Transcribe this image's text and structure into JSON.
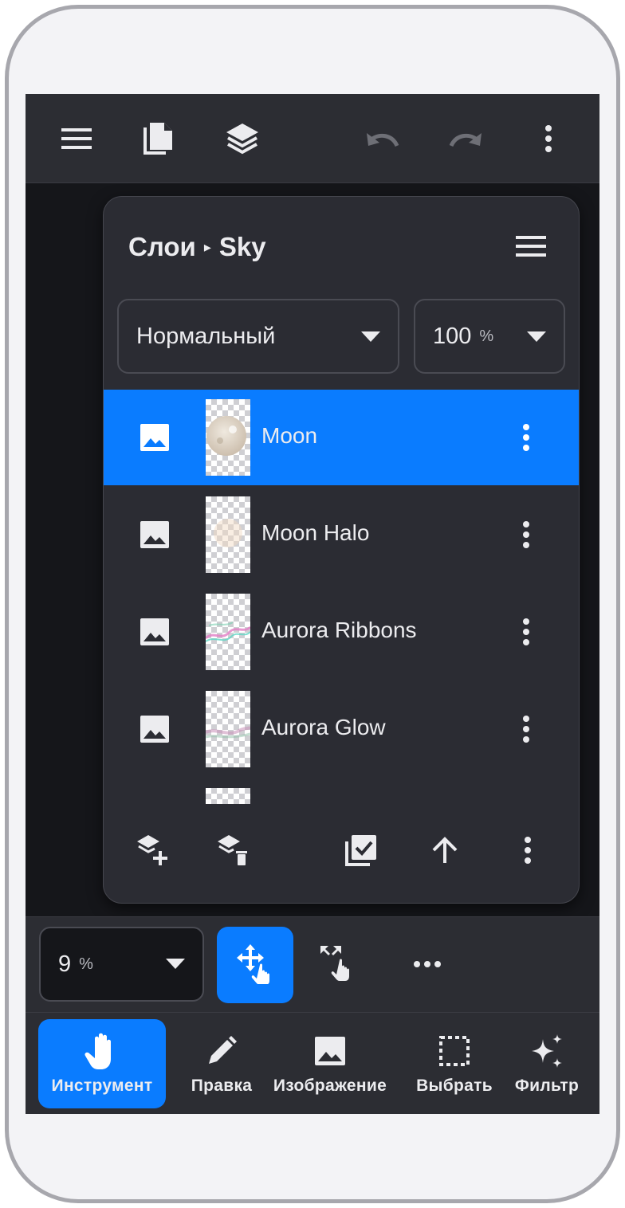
{
  "toolbar": {
    "icons": [
      "menu-icon",
      "pages-icon",
      "layers-icon",
      "undo-icon",
      "redo-icon",
      "more-vertical-icon"
    ]
  },
  "layers_panel": {
    "title": "Слои",
    "separator": "▸",
    "document": "Sky",
    "blend_mode": "Нормальный",
    "opacity_value": "100",
    "opacity_unit": "%",
    "layers": [
      {
        "name": "Moon",
        "selected": true
      },
      {
        "name": "Moon Halo",
        "selected": false
      },
      {
        "name": "Aurora Ribbons",
        "selected": false
      },
      {
        "name": "Aurora Glow",
        "selected": false
      }
    ],
    "footer_icons": [
      "add-layer-icon",
      "delete-layer-icon",
      "merge-check-icon",
      "arrow-up-icon",
      "more-vertical-icon"
    ]
  },
  "toolstrip": {
    "zoom_value": "9",
    "zoom_unit": "%"
  },
  "bottom_nav": {
    "items": [
      {
        "label": "Инструмент",
        "icon": "hand-icon",
        "active": true
      },
      {
        "label": "Правка",
        "icon": "pencil-icon",
        "active": false
      },
      {
        "label": "Изображение",
        "icon": "image-icon",
        "active": false
      },
      {
        "label": "Выбрать",
        "icon": "selection-icon",
        "active": false
      },
      {
        "label": "Фильтр",
        "icon": "sparkles-icon",
        "active": false
      }
    ]
  },
  "colors": {
    "accent": "#0a7cff",
    "panel_bg": "#2b2c33",
    "bar_bg": "#2c2d33",
    "canvas_bg": "#15161a",
    "text": "#ececef"
  }
}
